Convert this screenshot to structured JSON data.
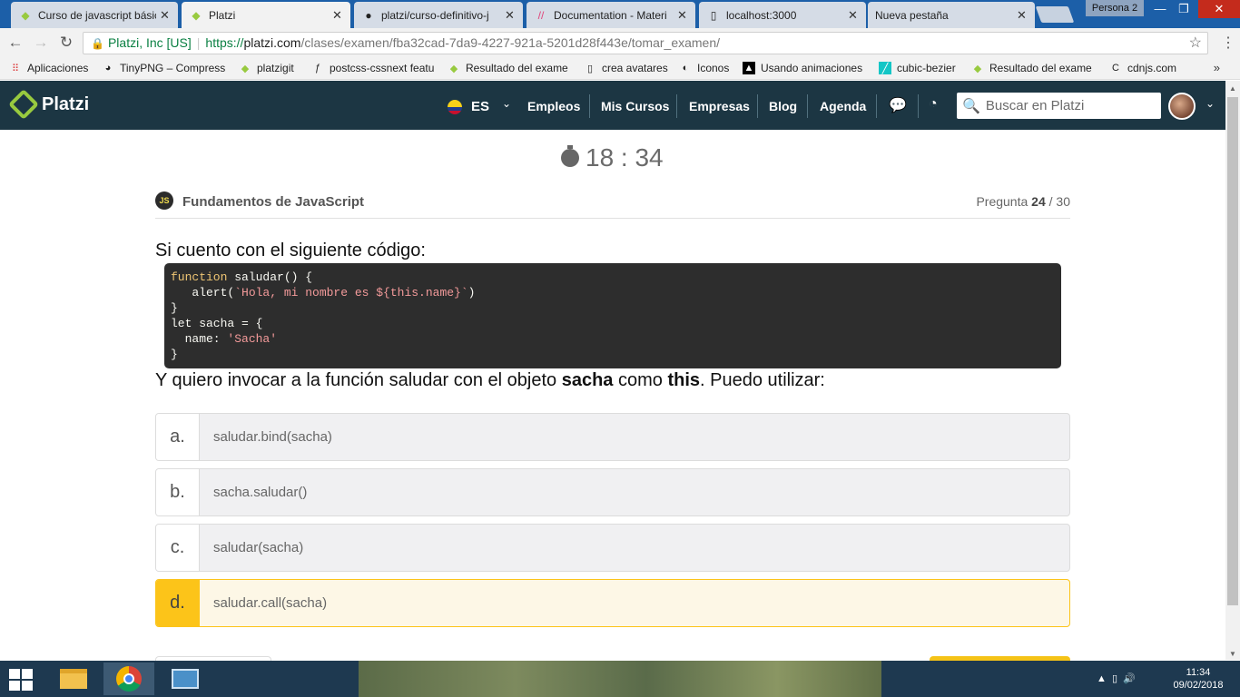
{
  "browser": {
    "tabs": [
      {
        "title": "Curso de javascript básic",
        "active": false
      },
      {
        "title": "Platzi",
        "active": true
      },
      {
        "title": "platzi/curso-definitivo-j",
        "active": false
      },
      {
        "title": "Documentation - Materi",
        "active": false
      },
      {
        "title": "localhost:3000",
        "active": false
      },
      {
        "title": "Nueva pestaña",
        "active": false
      }
    ],
    "profile": "Persona 2",
    "address": {
      "site_label": "Platzi, Inc [US]",
      "protocol": "https://",
      "host": "platzi.com",
      "path": "/clases/examen/fba32cad-7da9-4227-921a-5201d28f443e/tomar_examen/"
    },
    "bookmarks": [
      "Aplicaciones",
      "TinyPNG – Compress",
      "platzigit",
      "postcss-cssnext featu",
      "Resultado del exame",
      "crea avatares",
      "Iconos",
      "Usando animaciones",
      "cubic-bezier",
      "Resultado del exame",
      "cdnjs.com"
    ],
    "bookmarks_more": "»"
  },
  "header": {
    "logo": "Platzi",
    "language": "ES",
    "nav": [
      "Empleos",
      "Mis Cursos",
      "Empresas",
      "Blog",
      "Agenda"
    ],
    "search_placeholder": "Buscar en Platzi"
  },
  "exam": {
    "timer": "18 : 34",
    "course_badge": "JS",
    "course": "Fundamentos de JavaScript",
    "question_label": "Pregunta",
    "question_current": "24",
    "question_total": " / 30",
    "intro": "Si cuento con el siguiente código:",
    "code": {
      "l1_kw": "function",
      "l1_rest": " saludar() {",
      "l2_a": "   alert(",
      "l2_str": "`Hola, mi nombre es ${this.name}`",
      "l2_b": ")",
      "l3": "}",
      "l4": "let sacha = {",
      "l5_a": "  name: ",
      "l5_str": "'Sacha'",
      "l6": "}"
    },
    "question": {
      "pre": "Y quiero invocar a la función saludar con el objeto ",
      "obj": "sacha",
      "mid": " como ",
      "this_kw": "this",
      "post": ". Puedo utilizar:"
    },
    "options": [
      {
        "letter": "a.",
        "text": "saludar.bind(sacha)",
        "selected": false
      },
      {
        "letter": "b.",
        "text": "sacha.saludar()",
        "selected": false
      },
      {
        "letter": "c.",
        "text": "saludar(sacha)",
        "selected": false
      },
      {
        "letter": "d.",
        "text": "saludar.call(sacha)",
        "selected": true
      }
    ]
  },
  "taskbar": {
    "time": "11:34",
    "date": "09/02/2018"
  },
  "colors": {
    "header_bg": "#1c3643",
    "brand_green": "#98ca3f",
    "selected_option": "#fcc419",
    "code_bg": "#2d2d2d"
  }
}
